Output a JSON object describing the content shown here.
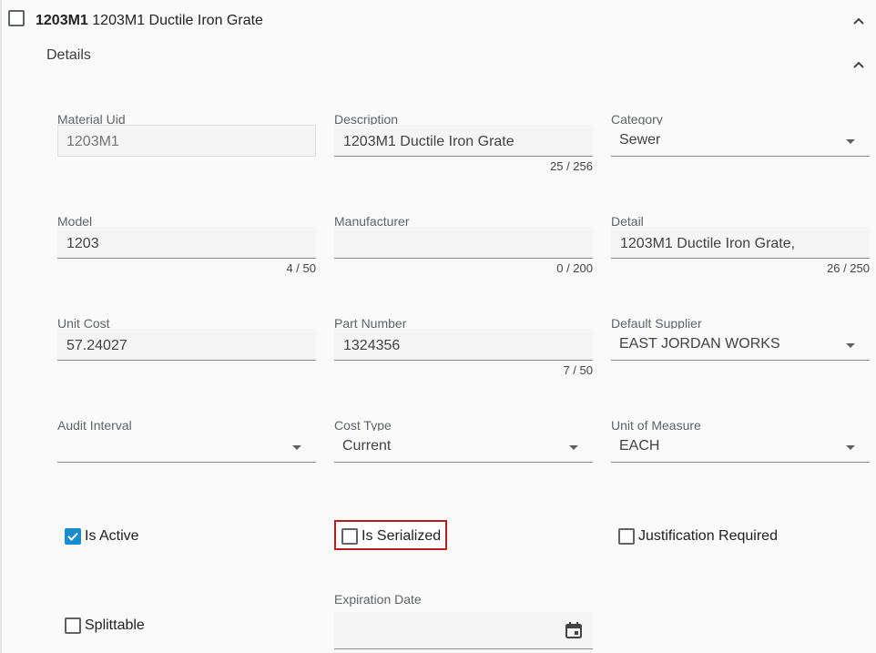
{
  "header": {
    "code": "1203M1",
    "title": "1203M1 Ductile Iron Grate"
  },
  "section": {
    "title": "Details"
  },
  "fields": {
    "material_uid": {
      "label": "Material Uid",
      "value": "1203M1"
    },
    "description": {
      "label": "Description",
      "value": "1203M1 Ductile Iron Grate",
      "counter": "25 / 256"
    },
    "category": {
      "label": "Category",
      "value": "Sewer"
    },
    "model": {
      "label": "Model",
      "value": "1203",
      "counter": "4 / 50"
    },
    "manufacturer": {
      "label": "Manufacturer",
      "value": "",
      "counter": "0 / 200"
    },
    "detail": {
      "label": "Detail",
      "value": "1203M1 Ductile Iron Grate,",
      "counter": "26 / 250"
    },
    "unit_cost": {
      "label": "Unit Cost",
      "value": "57.24027"
    },
    "part_number": {
      "label": "Part Number",
      "value": "1324356",
      "counter": "7 / 50"
    },
    "default_supplier": {
      "label": "Default Supplier",
      "value": "EAST JORDAN WORKS"
    },
    "audit_interval": {
      "label": "Audit Interval",
      "value": ""
    },
    "cost_type": {
      "label": "Cost Type",
      "value": "Current"
    },
    "unit_of_measure": {
      "label": "Unit of Measure",
      "value": "EACH"
    },
    "expiration_date": {
      "label": "Expiration Date",
      "value": ""
    }
  },
  "checkboxes": {
    "is_active": {
      "label": "Is Active",
      "checked": true
    },
    "is_serialized": {
      "label": "Is Serialized",
      "checked": false
    },
    "justification_required": {
      "label": "Justification Required",
      "checked": false
    },
    "splittable": {
      "label": "Splittable",
      "checked": false
    }
  },
  "colors": {
    "accent": "#1a8ccc",
    "highlight_border": "#b71c1c"
  },
  "icons": {
    "collapse": "chevron-up-icon",
    "calendar": "calendar-icon"
  }
}
